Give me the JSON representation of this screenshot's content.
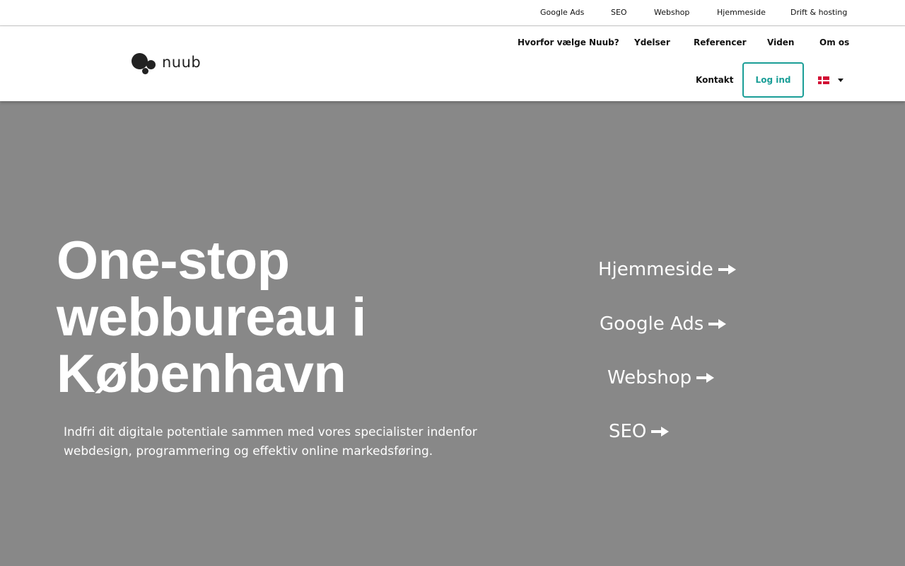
{
  "topbar": {
    "links": [
      "Google Ads",
      "SEO",
      "Webshop",
      "Hjemmeside",
      "Drift & hosting"
    ]
  },
  "header": {
    "logo_text": "nuub",
    "nav": [
      "Hvorfor vælge Nuub?",
      "Ydelser",
      "Referencer",
      "Viden",
      "Om os",
      "Kontakt"
    ],
    "login_label": "Log ind",
    "language_icon": "danish-flag-icon",
    "accent_color": "#1a9e97"
  },
  "hero": {
    "title_lines": [
      "One-stop",
      "webbureau i",
      "København"
    ],
    "subtitle_lines": [
      "Indfri dit digitale potentiale sammen med vores specialister indenfor",
      "webdesign, programmering og effektiv online markedsføring."
    ],
    "services": [
      "Hjemmeside",
      "Google Ads",
      "Webshop",
      "SEO"
    ],
    "service_icon": "arrow-right-icon",
    "background_color": "#888888"
  }
}
